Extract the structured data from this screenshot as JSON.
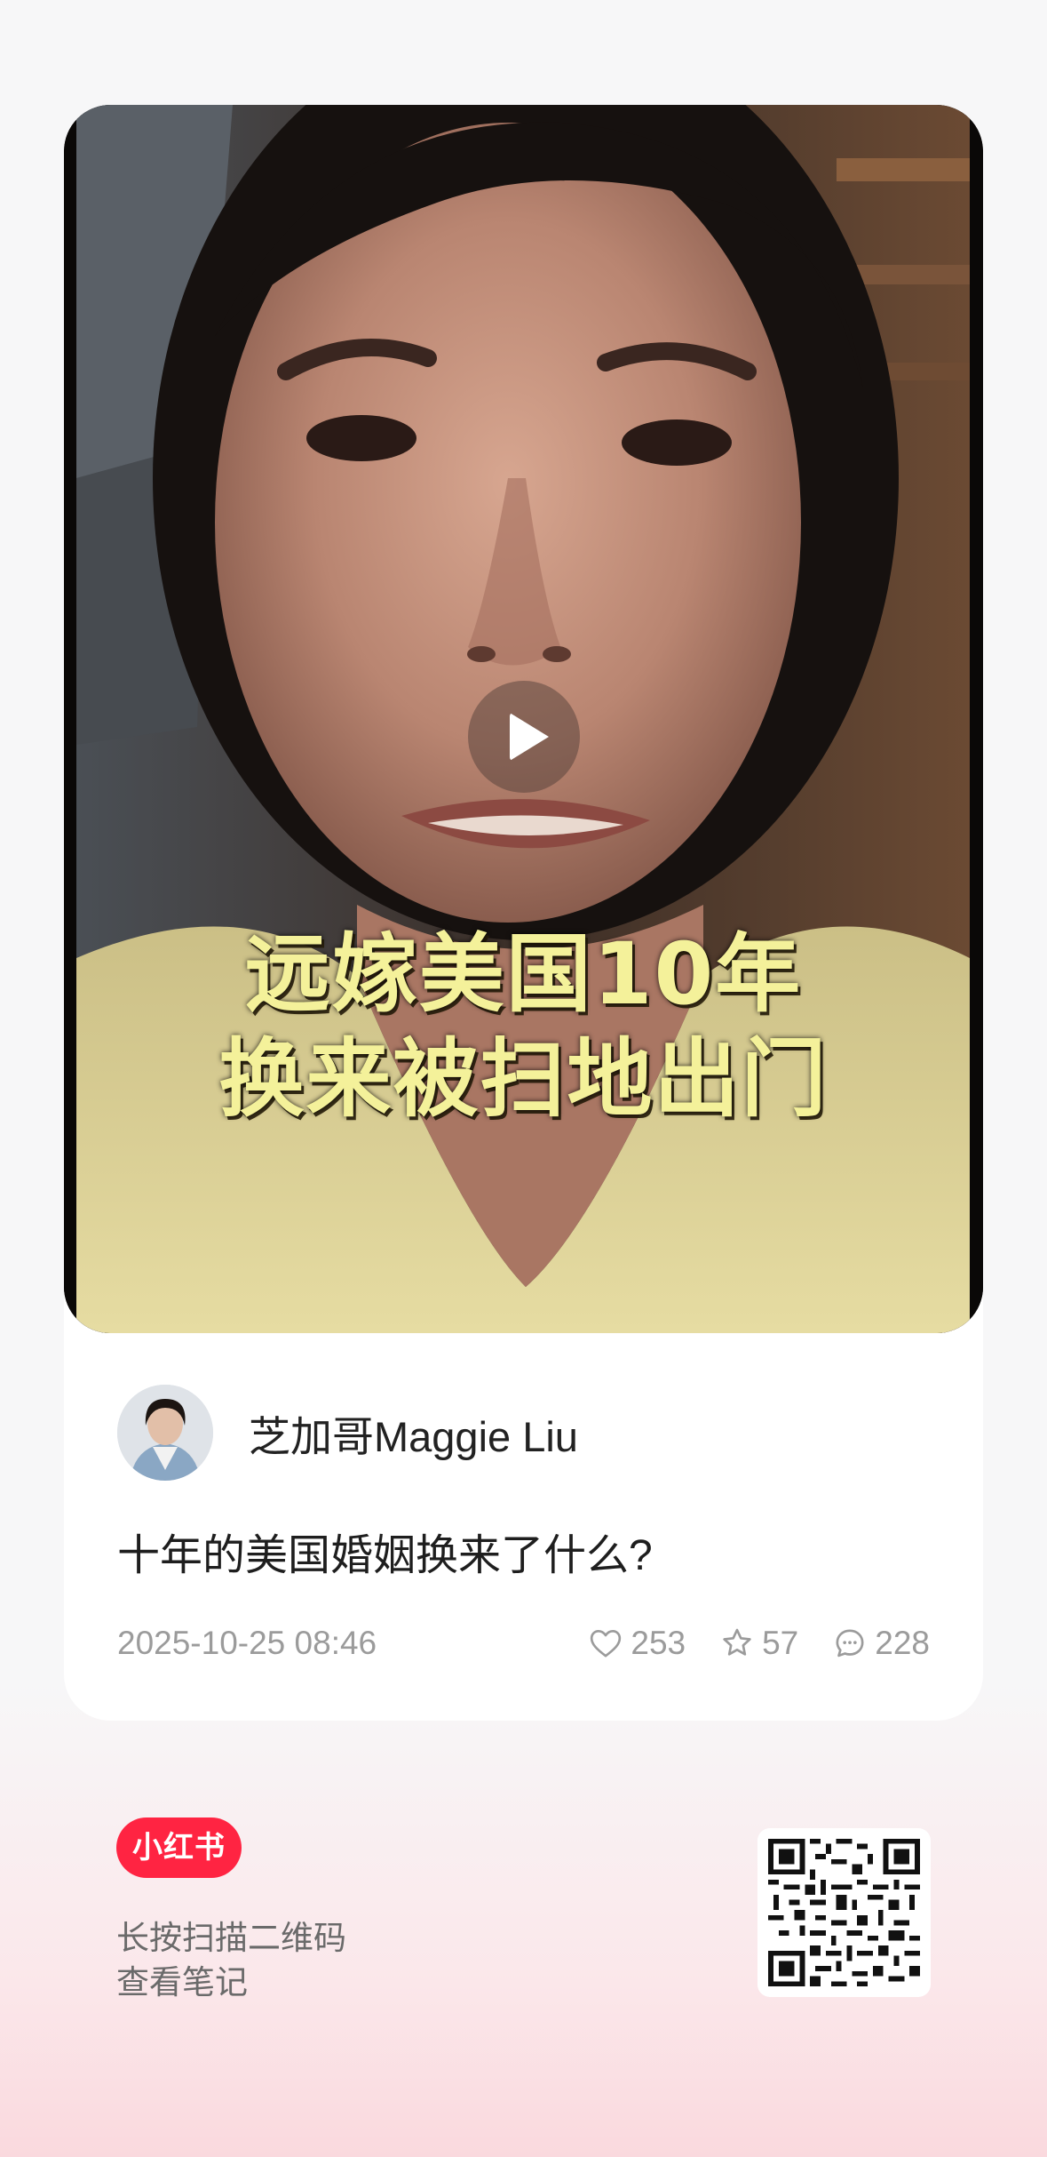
{
  "video": {
    "caption_line1": "远嫁美国10年",
    "caption_line2": "换来被扫地出门",
    "play_icon": "play-icon"
  },
  "author": {
    "name": "芝加哥Maggie Liu",
    "avatar_icon": "avatar-photo"
  },
  "note": {
    "title": "十年的美国婚姻换来了什么?",
    "date": "2025-10-25 08:46",
    "likes": "253",
    "collects": "57",
    "comments": "228"
  },
  "footer": {
    "brand": "小红书",
    "line1": "长按扫描二维码",
    "line2": "查看笔记",
    "qr_icon": "qr-code"
  },
  "colors": {
    "brand_red": "#ff2442",
    "caption_yellow": "#f4f19a",
    "meta_gray": "#9b9b9b"
  }
}
